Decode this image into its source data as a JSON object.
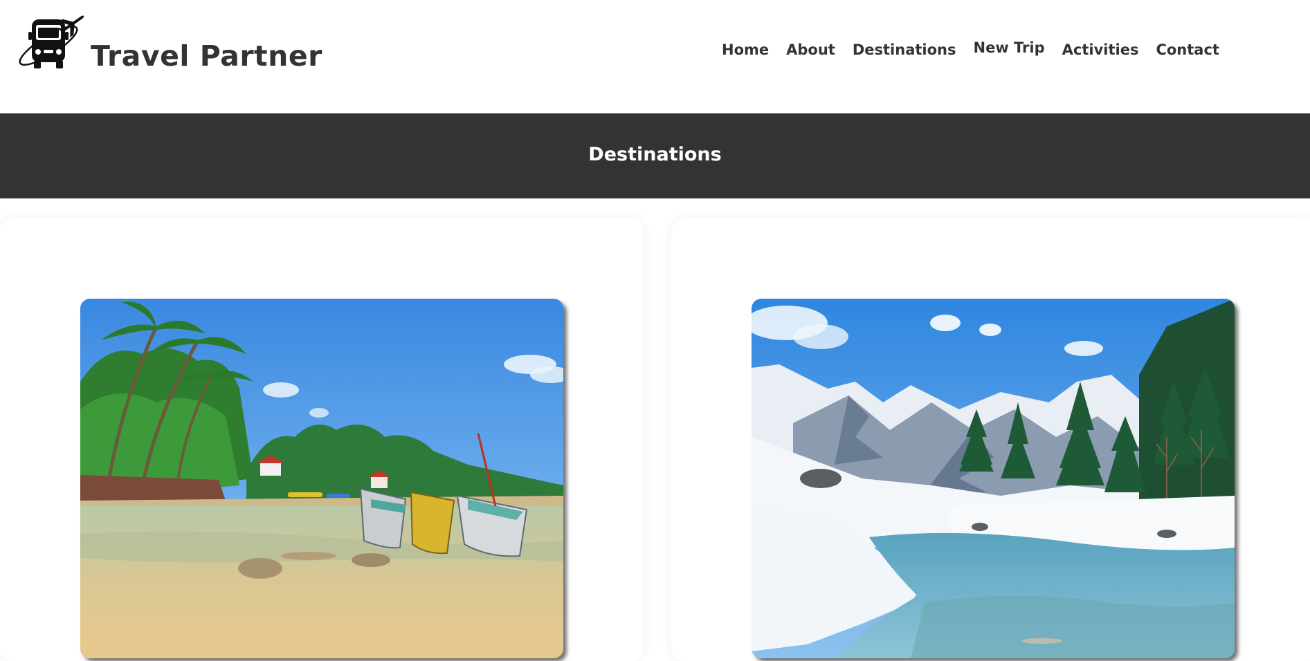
{
  "brand": {
    "name": "Travel Partner",
    "logo_icon": "bus-with-airplane-icon"
  },
  "nav": {
    "items": [
      {
        "label": "Home"
      },
      {
        "label": "About"
      },
      {
        "label": "Destinations"
      },
      {
        "label": "New Trip"
      },
      {
        "label": "Activities"
      },
      {
        "label": "Contact"
      }
    ]
  },
  "banner": {
    "title": "Destinations"
  },
  "destinations": [
    {
      "image_icon": "tropical-beach-boats-photo"
    },
    {
      "image_icon": "snowy-mountain-river-photo"
    }
  ],
  "colors": {
    "text": "#333333",
    "banner_bg": "#333333",
    "banner_text": "#ffffff",
    "page_bg": "#ffffff"
  }
}
